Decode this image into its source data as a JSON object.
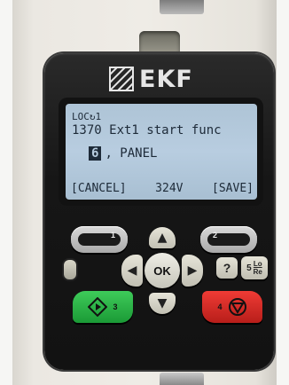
{
  "brand": {
    "name": "EKF"
  },
  "display": {
    "line1": "LOC↻1",
    "line2": "1370 Ext1 start func",
    "selected_value": "6",
    "value_text": ", PANEL",
    "softkey_left": "[CANCEL]",
    "clock": "324V",
    "softkey_right": "[SAVE]"
  },
  "keys": {
    "softkey1_num": "1",
    "softkey2_num": "2",
    "ok_label": "OK",
    "help_label": "?",
    "locrem_num": "5",
    "locrem_top": "Lo",
    "locrem_bottom": "Re",
    "start_num": "3",
    "stop_num": "4"
  },
  "icons": {
    "up": "arrow-up-icon",
    "down": "arrow-down-icon",
    "left": "arrow-left-icon",
    "right": "arrow-right-icon",
    "start": "start-diamond-icon",
    "stop": "stop-triangle-icon"
  },
  "colors": {
    "start": "#2bb549",
    "stop": "#e0302a",
    "lcd": "#b8cde0"
  }
}
